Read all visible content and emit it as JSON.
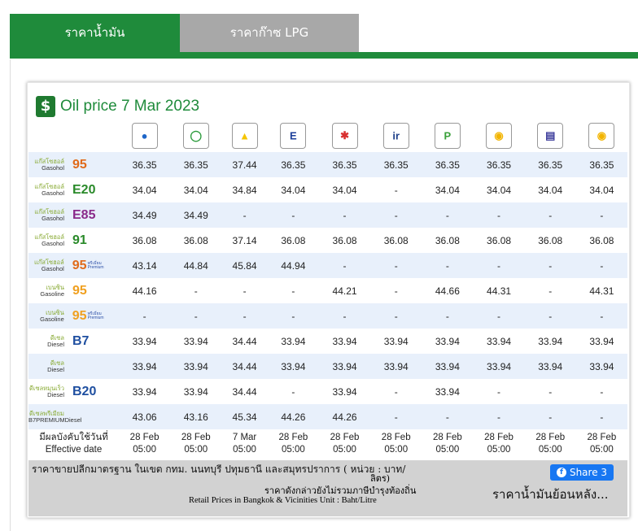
{
  "tabs": {
    "oil": "ราคาน้ำมัน",
    "lpg": "ราคาก๊าซ LPG"
  },
  "title": "Oil price 7 Mar 2023",
  "brands": [
    "PTT",
    "Bangchak",
    "Shell",
    "Esso",
    "Caltex",
    "IRPC",
    "PT",
    "Susco",
    "Pure",
    "Susco Dealers"
  ],
  "rows": [
    {
      "th": "แก๊สโซฮอล์",
      "en": "Gasohol",
      "num": "95",
      "color": "#e06a1a",
      "prem": "",
      "values": [
        "36.35",
        "36.35",
        "37.44",
        "36.35",
        "36.35",
        "36.35",
        "36.35",
        "36.35",
        "36.35",
        "36.35"
      ]
    },
    {
      "th": "แก๊สโซฮอล์",
      "en": "Gasohol",
      "num": "E20",
      "color": "#2a8a2a",
      "prem": "",
      "values": [
        "34.04",
        "34.04",
        "34.84",
        "34.04",
        "34.04",
        "-",
        "34.04",
        "34.04",
        "34.04",
        "34.04"
      ]
    },
    {
      "th": "แก๊สโซฮอล์",
      "en": "Gasohol",
      "num": "E85",
      "color": "#8a2a8a",
      "prem": "",
      "values": [
        "34.49",
        "34.49",
        "-",
        "-",
        "-",
        "-",
        "-",
        "-",
        "-",
        "-"
      ]
    },
    {
      "th": "แก๊สโซฮอล์",
      "en": "Gasohol",
      "num": "91",
      "color": "#2a8a2a",
      "prem": "",
      "values": [
        "36.08",
        "36.08",
        "37.14",
        "36.08",
        "36.08",
        "36.08",
        "36.08",
        "36.08",
        "36.08",
        "36.08"
      ]
    },
    {
      "th": "แก๊สโซฮอล์",
      "en": "Gasohol",
      "num": "95",
      "color": "#e06a1a",
      "prem": "พรีเมี่ยม Premium",
      "values": [
        "43.14",
        "44.84",
        "45.84",
        "44.94",
        "-",
        "-",
        "-",
        "-",
        "-",
        "-"
      ]
    },
    {
      "th": "เบนซิน",
      "en": "Gasoline",
      "num": "95",
      "color": "#f0a020",
      "prem": "",
      "values": [
        "44.16",
        "-",
        "-",
        "-",
        "44.21",
        "-",
        "44.66",
        "44.31",
        "-",
        "44.31"
      ]
    },
    {
      "th": "เบนซิน",
      "en": "Gasoline",
      "num": "95",
      "color": "#f0a020",
      "prem": "พรีเมี่ยม Premium",
      "values": [
        "-",
        "-",
        "-",
        "-",
        "-",
        "-",
        "-",
        "-",
        "-",
        "-"
      ]
    },
    {
      "th": "ดีเซล",
      "en": "Diesel",
      "num": "B7",
      "color": "#1f4fa0",
      "prem": "",
      "values": [
        "33.94",
        "33.94",
        "34.44",
        "33.94",
        "33.94",
        "33.94",
        "33.94",
        "33.94",
        "33.94",
        "33.94"
      ]
    },
    {
      "th": "ดีเซล",
      "en": "Diesel",
      "num": "",
      "color": "#1f4fa0",
      "prem": "",
      "values": [
        "33.94",
        "33.94",
        "34.44",
        "33.94",
        "33.94",
        "33.94",
        "33.94",
        "33.94",
        "33.94",
        "33.94"
      ]
    },
    {
      "th": "ดีเซลหมุนเร็ว",
      "en": "Diesel",
      "num": "B20",
      "color": "#1f4fa0",
      "prem": "",
      "values": [
        "33.94",
        "33.94",
        "34.44",
        "-",
        "33.94",
        "-",
        "33.94",
        "-",
        "-",
        "-"
      ]
    },
    {
      "th": "ดีเซลพรีเมียม",
      "en": "B7PREMIUMDiesel",
      "num": "",
      "color": "#1f4fa0",
      "prem": "",
      "values": [
        "43.06",
        "43.16",
        "45.34",
        "44.26",
        "44.26",
        "-",
        "-",
        "-",
        "-",
        "-"
      ]
    }
  ],
  "effective": {
    "label_th": "มีผลบังคับใช้วันที่",
    "label_en": "Effective date",
    "dates": [
      "28 Feb",
      "28 Feb",
      "7 Mar",
      "28 Feb",
      "28 Feb",
      "28 Feb",
      "28 Feb",
      "28 Feb",
      "28 Feb",
      "28 Feb"
    ],
    "times": [
      "05:00",
      "05:00",
      "05:00",
      "05:00",
      "05:00",
      "05:00",
      "05:00",
      "05:00",
      "05:00",
      "05:00"
    ]
  },
  "footer": {
    "note1": "ราคาขายปลีกมาตรฐาน ในเขต กทม. นนทบุรี ปทุมธานี และสมุทรปราการ ( หน่วย : บาท/",
    "note2": "ลิตร)",
    "note3": "ราคาดังกล่าวยังไม่รวมภาษีบำรุงท้องถิ่น",
    "note4": "Retail Prices in Bangkok & Vicinities Unit : Baht/Litre",
    "share": "Share 3",
    "history": "ราคาน้ำมันย้อนหลัง..."
  }
}
